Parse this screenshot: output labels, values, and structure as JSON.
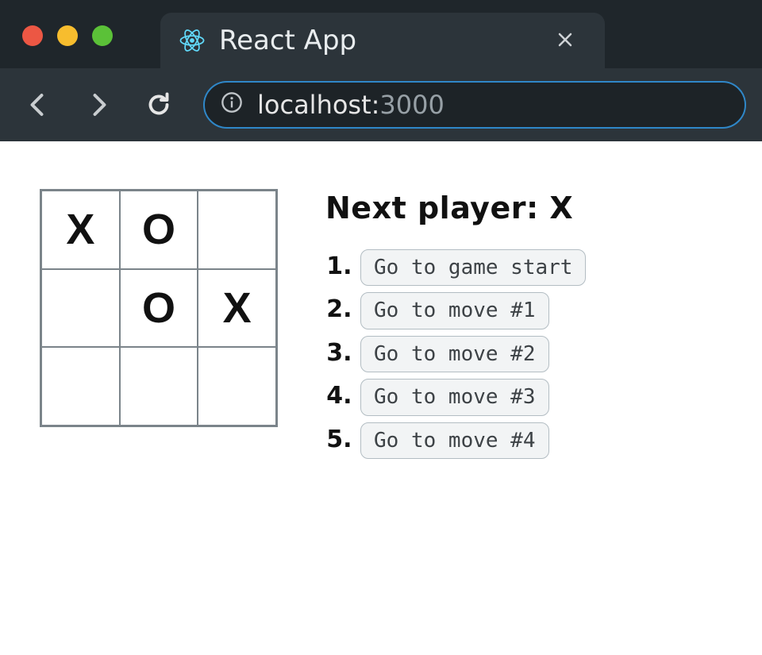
{
  "browser": {
    "tab_title": "React App",
    "url_host": "localhost:",
    "url_port": "3000"
  },
  "game": {
    "status": "Next player: X",
    "board": [
      "X",
      "O",
      "",
      "",
      "O",
      "X",
      "",
      "",
      ""
    ],
    "moves": [
      {
        "num": "1.",
        "label": "Go to game start"
      },
      {
        "num": "2.",
        "label": "Go to move #1"
      },
      {
        "num": "3.",
        "label": "Go to move #2"
      },
      {
        "num": "4.",
        "label": "Go to move #3"
      },
      {
        "num": "5.",
        "label": "Go to move #4"
      }
    ]
  }
}
